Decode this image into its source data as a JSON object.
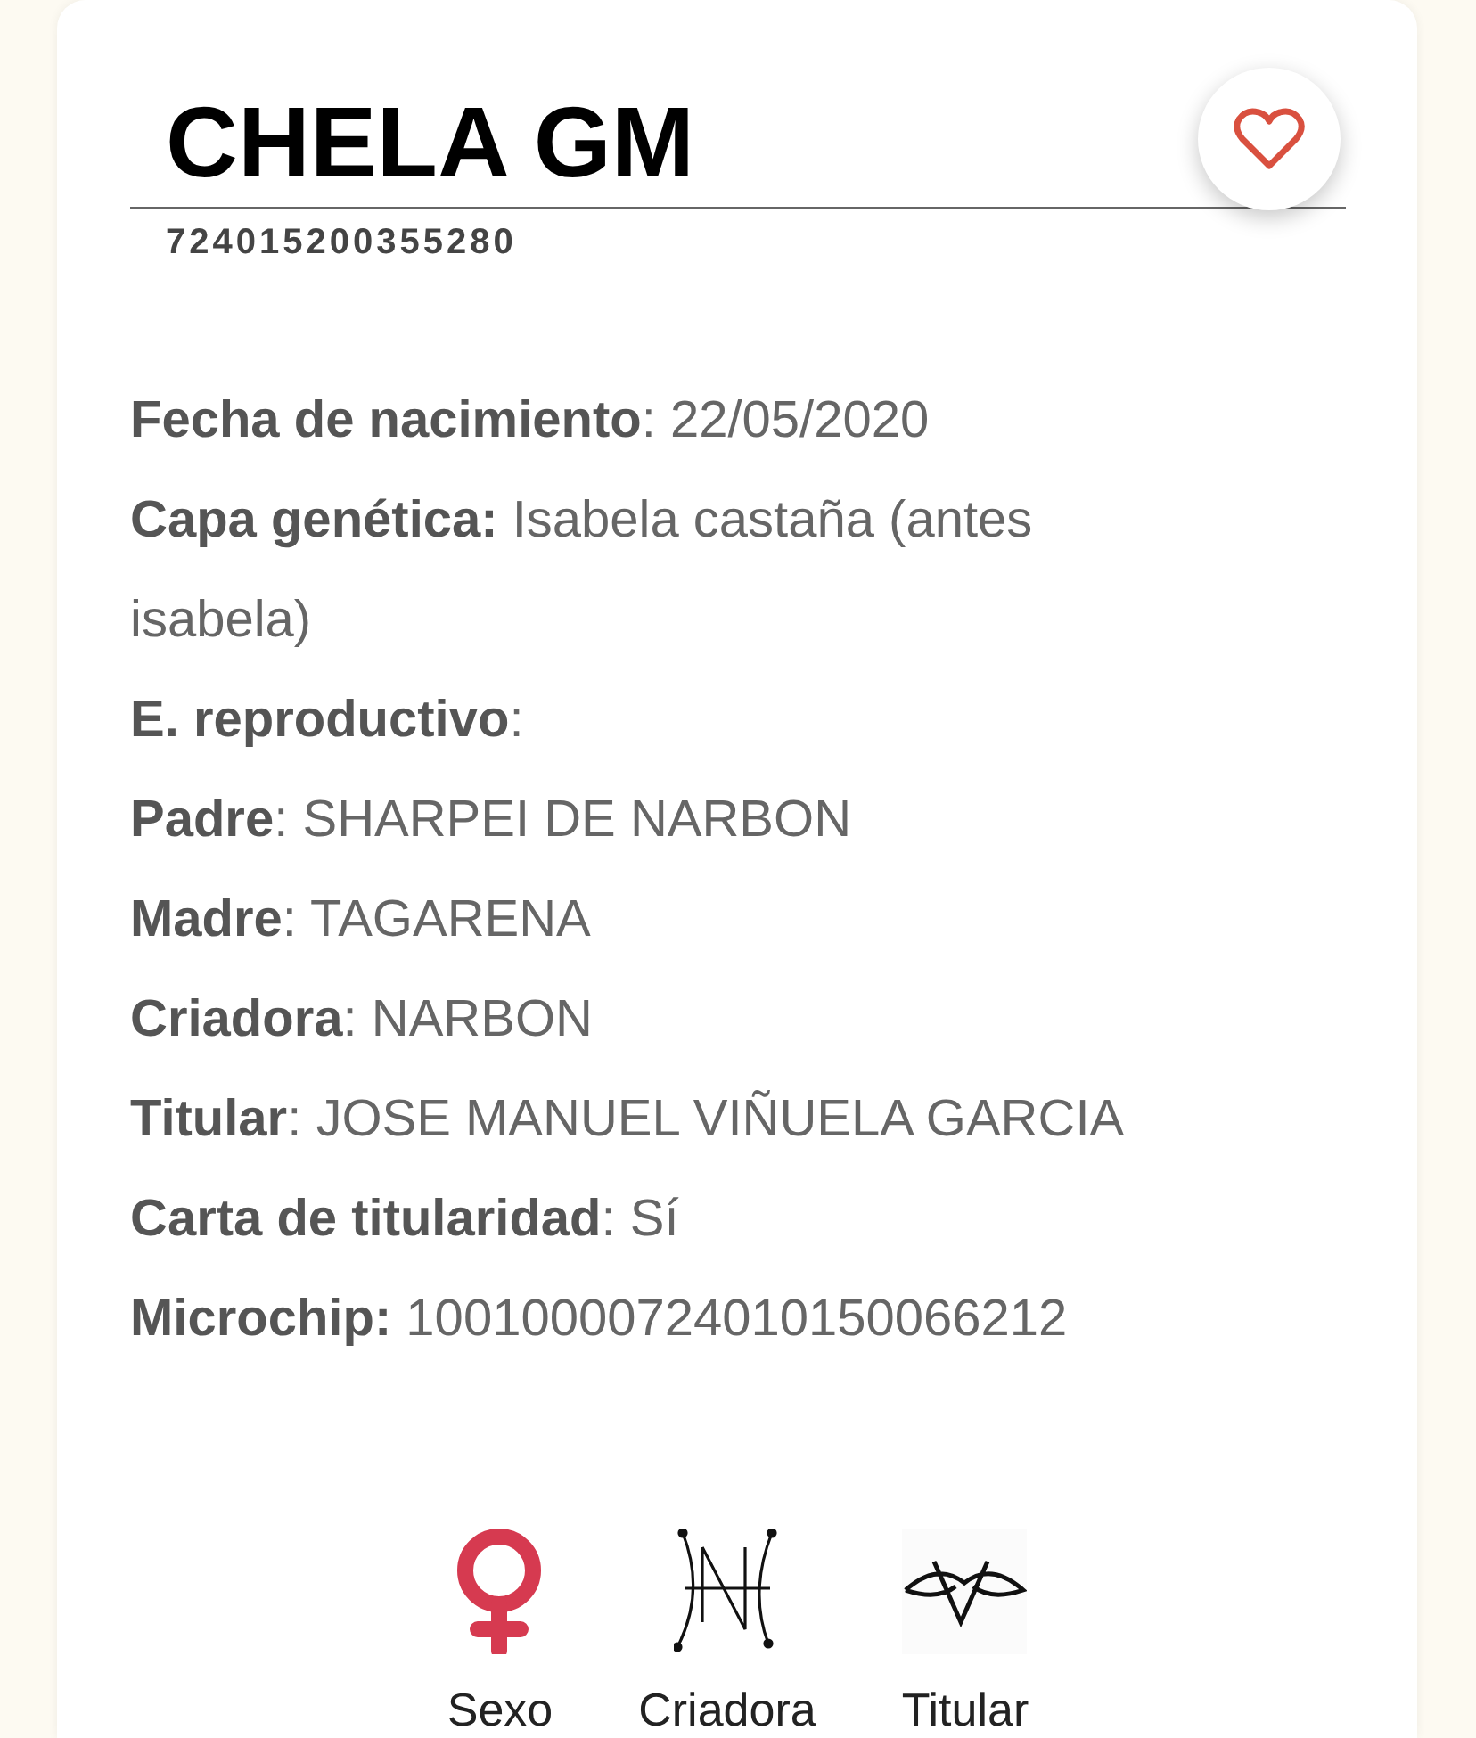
{
  "title": "CHELA GM",
  "code": "724015200355280",
  "favorite": false,
  "details": [
    "**Fecha de nacimiento**: 22/05/2020",
    "**Capa genética:** Isabela castaña (antes isabela)",
    "**E. reproductivo**:",
    "**Padre**: SHARPEI DE NARBON",
    "**Madre**: TAGARENA",
    "**Criadora**: NARBON",
    "**Titular**: JOSE MANUEL VIÑUELA GARCIA",
    "**Carta de titularidad**: Sí",
    "**Microchip:** 10010000724010150066212"
  ],
  "badges": [
    {
      "kind": "sex",
      "label": "Sexo"
    },
    {
      "kind": "breeder",
      "label": "Criadora"
    },
    {
      "kind": "owner",
      "label": "Titular"
    }
  ]
}
